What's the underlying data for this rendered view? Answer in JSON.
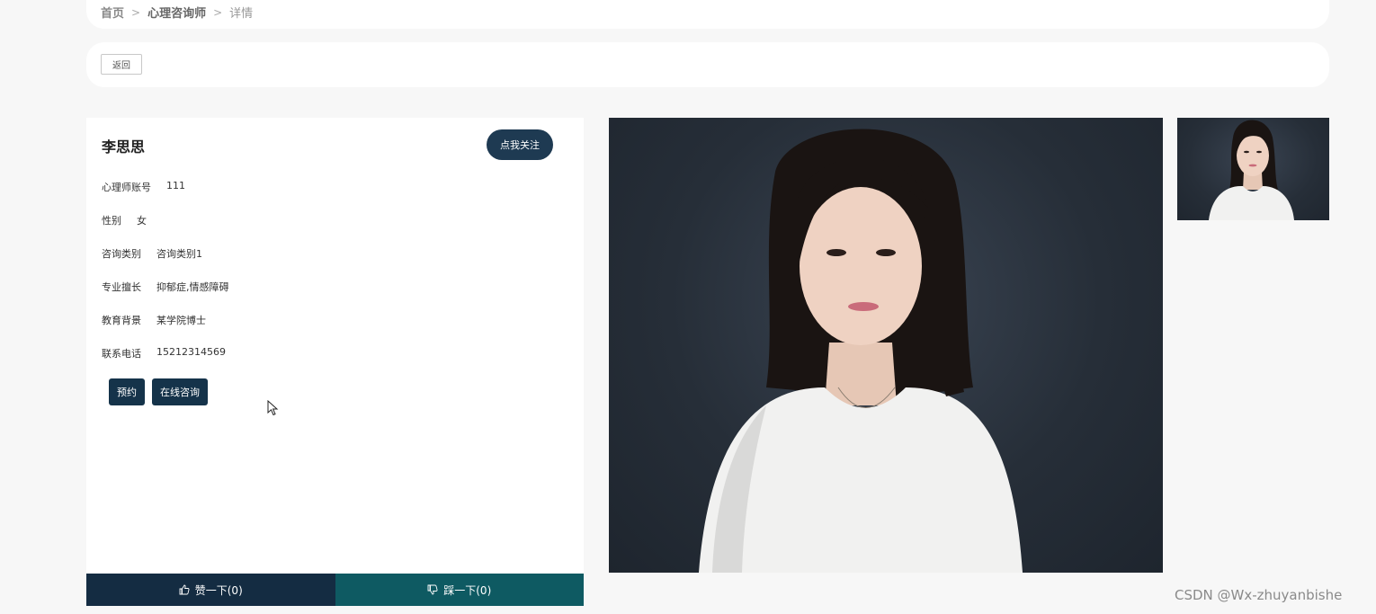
{
  "breadcrumb": {
    "home": "首页",
    "separator": ">",
    "category": "心理咨询师",
    "current": "详情"
  },
  "toolbar": {
    "back_label": "返回"
  },
  "counselor": {
    "name": "李思思",
    "follow_label": "点我关注",
    "fields": [
      {
        "label": "心理师账号",
        "value": "111"
      },
      {
        "label": "性别",
        "value": "女"
      },
      {
        "label": "咨询类别",
        "value": "咨询类别1"
      },
      {
        "label": "专业擅长",
        "value": "抑郁症,情感障碍"
      },
      {
        "label": "教育背景",
        "value": "某学院博士"
      },
      {
        "label": "联系电话",
        "value": "15212314569"
      }
    ]
  },
  "actions": {
    "book_label": "预约",
    "consult_label": "在线咨询"
  },
  "votes": {
    "up_label": "赞一下(0)",
    "down_label": "踩一下(0)"
  },
  "watermark": "CSDN @Wx-zhuyanbishe",
  "colors": {
    "primary": "#1e3a52",
    "vote_up": "#142c42",
    "vote_down": "#0e5a62"
  },
  "icons": {
    "thumbs_up": "thumbs-up-icon",
    "thumbs_down": "thumbs-down-icon",
    "cursor": "mouse-cursor-icon"
  }
}
